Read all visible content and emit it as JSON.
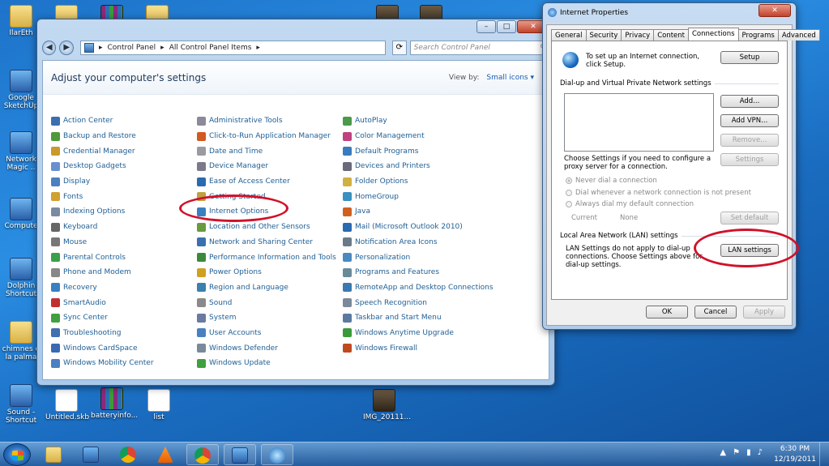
{
  "desktop": {
    "icons": [
      {
        "label": "IlarEth",
        "type": "folder"
      },
      {
        "label": "Google SketchUp",
        "type": "app"
      },
      {
        "label": "Network Magic ..",
        "type": "app"
      },
      {
        "label": "Compute",
        "type": "app"
      },
      {
        "label": "Dolphin Shortcut",
        "type": "app"
      },
      {
        "label": "chimnes d la palma",
        "type": "folder"
      },
      {
        "label": "Sound - Shortcut",
        "type": "app"
      },
      {
        "label": "Untitled.skb",
        "type": "doc"
      },
      {
        "label": "batteryinfo...",
        "type": "rar"
      },
      {
        "label": "list",
        "type": "doc"
      },
      {
        "label": "IMG_20111...",
        "type": "photo"
      }
    ]
  },
  "control_panel": {
    "breadcrumb": [
      "Control Panel",
      "All Control Panel Items"
    ],
    "search_placeholder": "Search Control Panel",
    "heading": "Adjust your computer's settings",
    "view_by_label": "View by:",
    "view_by_value": "Small icons",
    "caption": {
      "minimize": "–",
      "maximize": "□",
      "close": "✕"
    },
    "columns": [
      [
        {
          "label": "Action Center",
          "color": "#3b6fb0"
        },
        {
          "label": "Backup and Restore",
          "color": "#4e9a3a"
        },
        {
          "label": "Credential Manager",
          "color": "#c89a2a"
        },
        {
          "label": "Desktop Gadgets",
          "color": "#6a8fd0"
        },
        {
          "label": "Display",
          "color": "#4a7fc0"
        },
        {
          "label": "Fonts",
          "color": "#d0a030"
        },
        {
          "label": "Indexing Options",
          "color": "#7a8aa0"
        },
        {
          "label": "Keyboard",
          "color": "#666666"
        },
        {
          "label": "Mouse",
          "color": "#777777"
        },
        {
          "label": "Parental Controls",
          "color": "#3aa04a"
        },
        {
          "label": "Phone and Modem",
          "color": "#888888"
        },
        {
          "label": "Recovery",
          "color": "#3a80c0"
        },
        {
          "label": "SmartAudio",
          "color": "#c03030"
        },
        {
          "label": "Sync Center",
          "color": "#40a040"
        },
        {
          "label": "Troubleshooting",
          "color": "#4070b0"
        },
        {
          "label": "Windows CardSpace",
          "color": "#3a6ab0"
        },
        {
          "label": "Windows Mobility Center",
          "color": "#4a80c0"
        }
      ],
      [
        {
          "label": "Administrative Tools",
          "color": "#8a8a9a"
        },
        {
          "label": "Click-to-Run Application Manager",
          "color": "#d05a20"
        },
        {
          "label": "Date and Time",
          "color": "#9a9aa0"
        },
        {
          "label": "Device Manager",
          "color": "#7a7a8a"
        },
        {
          "label": "Ease of Access Center",
          "color": "#2a6ab0"
        },
        {
          "label": "Getting Started",
          "color": "#c0a040"
        },
        {
          "label": "Internet Options",
          "color": "#3a80c0"
        },
        {
          "label": "Location and Other Sensors",
          "color": "#6a9a40"
        },
        {
          "label": "Network and Sharing Center",
          "color": "#3a70b0"
        },
        {
          "label": "Performance Information and Tools",
          "color": "#3a8a3a"
        },
        {
          "label": "Power Options",
          "color": "#d0a020"
        },
        {
          "label": "Region and Language",
          "color": "#3a80b0"
        },
        {
          "label": "Sound",
          "color": "#8a8a8a"
        },
        {
          "label": "System",
          "color": "#6a7aa0"
        },
        {
          "label": "User Accounts",
          "color": "#4a80c0"
        },
        {
          "label": "Windows Defender",
          "color": "#7a8a9a"
        },
        {
          "label": "Windows Update",
          "color": "#40a040"
        }
      ],
      [
        {
          "label": "AutoPlay",
          "color": "#4a9a4a"
        },
        {
          "label": "Color Management",
          "color": "#c04080"
        },
        {
          "label": "Default Programs",
          "color": "#3a7ac0"
        },
        {
          "label": "Devices and Printers",
          "color": "#6a6a7a"
        },
        {
          "label": "Folder Options",
          "color": "#d0b040"
        },
        {
          "label": "HomeGroup",
          "color": "#3a90c0"
        },
        {
          "label": "Java",
          "color": "#d06020"
        },
        {
          "label": "Mail (Microsoft Outlook 2010)",
          "color": "#2a6ab0"
        },
        {
          "label": "Notification Area Icons",
          "color": "#6a7a8a"
        },
        {
          "label": "Personalization",
          "color": "#4a8ac0"
        },
        {
          "label": "Programs and Features",
          "color": "#6a8a9a"
        },
        {
          "label": "RemoteApp and Desktop Connections",
          "color": "#3a7ab0"
        },
        {
          "label": "Speech Recognition",
          "color": "#7a8a9a"
        },
        {
          "label": "Taskbar and Start Menu",
          "color": "#5a7aa0"
        },
        {
          "label": "Windows Anytime Upgrade",
          "color": "#3a9a3a"
        },
        {
          "label": "Windows Firewall",
          "color": "#c04a20"
        }
      ]
    ]
  },
  "internet_properties": {
    "title": "Internet Properties",
    "close": "✕",
    "tabs": [
      "General",
      "Security",
      "Privacy",
      "Content",
      "Connections",
      "Programs",
      "Advanced"
    ],
    "active_tab": "Connections",
    "setup_text": "To set up an Internet connection, click Setup.",
    "setup_button": "Setup",
    "dialup_group": "Dial-up and Virtual Private Network settings",
    "add_button": "Add...",
    "add_vpn_button": "Add VPN...",
    "remove_button": "Remove...",
    "settings_text": "Choose Settings if you need to configure a proxy server for a connection.",
    "settings_button": "Settings",
    "radio_never": "Never dial a connection",
    "radio_whenever": "Dial whenever a network connection is not present",
    "radio_always": "Always dial my default connection",
    "current_label": "Current",
    "current_value": "None",
    "set_default_button": "Set default",
    "lan_group": "Local Area Network (LAN) settings",
    "lan_text": "LAN Settings do not apply to dial-up connections. Choose Settings above for dial-up settings.",
    "lan_button": "LAN settings",
    "ok_button": "OK",
    "cancel_button": "Cancel",
    "apply_button": "Apply"
  },
  "taskbar": {
    "time": "6:30 PM",
    "date": "12/19/2011",
    "tray_icons": [
      "▲",
      "⚑",
      "▮",
      "♪"
    ]
  }
}
